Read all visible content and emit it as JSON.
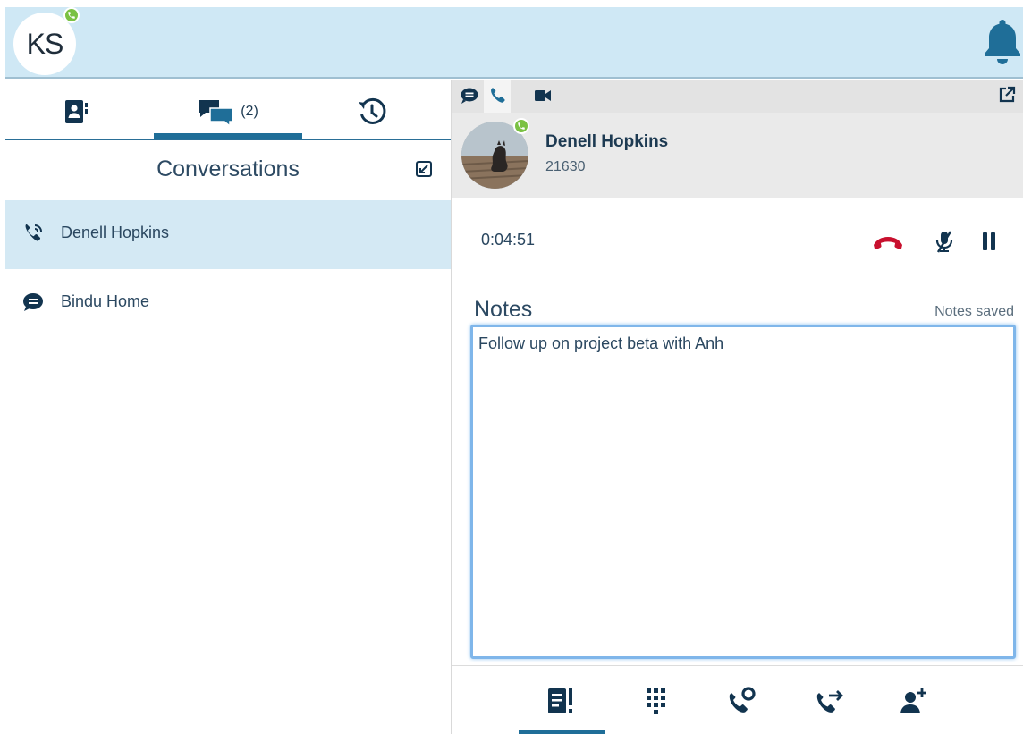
{
  "user": {
    "initials": "KS",
    "presence": "on-call"
  },
  "header": {
    "bell_icon": "bell-icon"
  },
  "left_tabs": [
    {
      "name": "contacts",
      "icon": "contact-book-icon"
    },
    {
      "name": "chats",
      "icon": "chat-bubbles-icon",
      "count": "(2)"
    },
    {
      "name": "history",
      "icon": "history-clock-icon"
    }
  ],
  "active_tab": "chats",
  "conversations": {
    "title": "Conversations",
    "items": [
      {
        "label": "Denell Hopkins",
        "icon": "phone-call-icon",
        "selected": true
      },
      {
        "label": "Bindu Home",
        "icon": "chat-icon",
        "selected": false
      }
    ]
  },
  "contact": {
    "name": "Denell Hopkins",
    "extension": "21630",
    "presence": "on-call"
  },
  "call": {
    "duration": "0:04:51"
  },
  "notes": {
    "label": "Notes",
    "status": "Notes saved",
    "text": "Follow up on project beta with Anh"
  },
  "colors": {
    "accent": "#1f6e98",
    "header_bg": "#cfe8f5",
    "selected_bg": "#d4e9f4",
    "presence_green": "#7ac143",
    "hangup_red": "#c8102e",
    "icon_navy": "#12344f"
  }
}
